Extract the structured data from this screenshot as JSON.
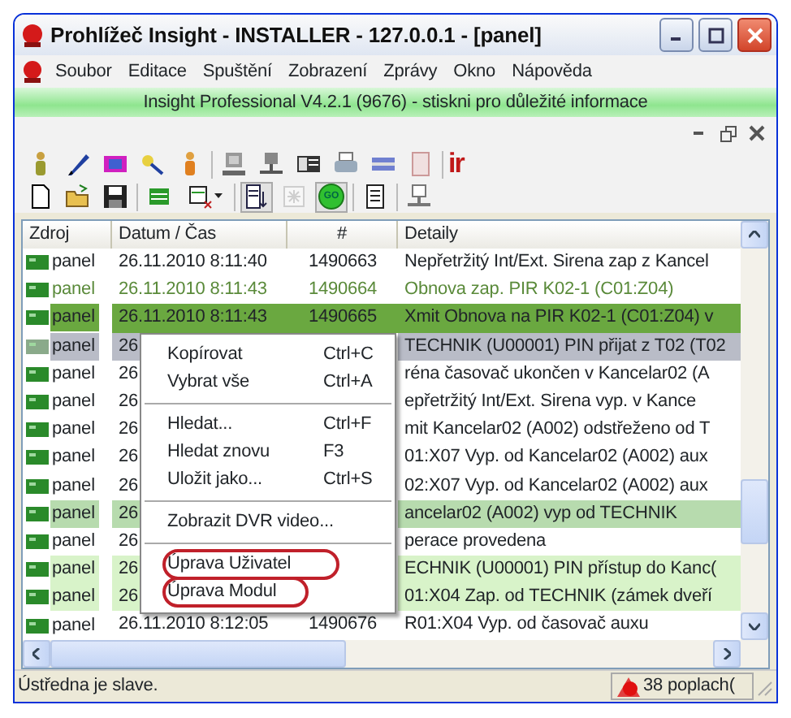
{
  "window": {
    "title": "Prohlížeč Insight - INSTALLER - 127.0.0.1 - [panel]"
  },
  "menu": [
    "Soubor",
    "Editace",
    "Spuštění",
    "Zobrazení",
    "Zprávy",
    "Okno",
    "Nápověda"
  ],
  "banner": "Insight Professional V4.2.1 (9676) - stiskni pro důležité informace",
  "toolbar_1": {
    "logo": "ir"
  },
  "toolbar_2": {
    "go_label": "GO",
    "buttons": [
      {
        "pressed": false,
        "disabled": false
      },
      {
        "pressed": false,
        "disabled": false
      },
      {
        "pressed": false,
        "disabled": false
      },
      {
        "pressed": false,
        "disabled": false
      },
      {
        "pressed": false,
        "disabled": false
      },
      {
        "pressed": true,
        "disabled": false
      },
      {
        "pressed": false,
        "disabled": true
      },
      {
        "pressed": true,
        "disabled": false
      },
      {
        "pressed": false,
        "disabled": false
      },
      {
        "pressed": false,
        "disabled": false
      }
    ]
  },
  "table": {
    "columns": [
      "Zdroj",
      "Datum / Čas",
      "#",
      "Detaily"
    ],
    "rows": [
      {
        "kind": "plain",
        "source": "panel",
        "datetime": "26.11.2010 8:11:40",
        "number": "1490663",
        "details": "Nepřetržitý Int/Ext. Sirena zap z Kancel"
      },
      {
        "kind": "restore",
        "source": "panel",
        "datetime": "26.11.2010 8:11:43",
        "number": "1490664",
        "details": "Obnova zap. PIR K02-1 (C01:Z04)"
      },
      {
        "kind": "selected",
        "source": "panel",
        "datetime": "26.11.2010 8:11:43",
        "number": "1490665",
        "details": "Xmit Obnova na PIR K02-1 (C01:Z04) v"
      },
      {
        "kind": "focused",
        "source": "panel",
        "datetime": "26",
        "details": "TECHNIK (U00001) PIN přijat z T02 (T02"
      },
      {
        "kind": "plain",
        "source": "panel",
        "datetime": "26",
        "details": "réna časovač ukončen v Kancelar02 (A"
      },
      {
        "kind": "plain",
        "source": "panel",
        "datetime": "26",
        "details": "epřetržitý Int/Ext. Sirena vyp. v Kance"
      },
      {
        "kind": "plain",
        "source": "panel",
        "datetime": "26",
        "details": "mit Kancelar02 (A002) odstřeženo od T"
      },
      {
        "kind": "plain",
        "source": "panel",
        "datetime": "26",
        "details": "01:X07 Vyp. od Kancelar02 (A002) aux"
      },
      {
        "kind": "plain",
        "source": "panel",
        "datetime": "26",
        "details": "02:X07 Vyp. od Kancelar02 (A002) aux"
      },
      {
        "kind": "marked",
        "source": "panel",
        "datetime": "26",
        "details": "ancelar02 (A002) vyp od TECHNIK"
      },
      {
        "kind": "plain",
        "source": "panel",
        "datetime": "26",
        "details": "perace provedena"
      },
      {
        "kind": "light",
        "source": "panel",
        "datetime": "26",
        "details": "ECHNIK (U00001) PIN přístup do Kanc("
      },
      {
        "kind": "light",
        "source": "panel",
        "datetime": "26",
        "details": "01:X04 Zap. od TECHNIK (zámek dveří"
      },
      {
        "kind": "plain",
        "source": "panel",
        "datetime": "26.11.2010 8:12:05",
        "number": "1490676",
        "details": "R01:X04 Vyp. od časovač auxu"
      }
    ]
  },
  "context_menu": [
    {
      "kind": "item",
      "label": "Kopírovat",
      "shortcut": "Ctrl+C",
      "circled": false
    },
    {
      "kind": "item",
      "label": "Vybrat vše",
      "shortcut": "Ctrl+A",
      "circled": false
    },
    {
      "kind": "separator"
    },
    {
      "kind": "item",
      "label": "Hledat...",
      "shortcut": "Ctrl+F",
      "circled": false
    },
    {
      "kind": "item",
      "label": "Hledat znovu",
      "shortcut": "F3",
      "circled": false
    },
    {
      "kind": "item",
      "label": "Uložit jako...",
      "shortcut": "Ctrl+S",
      "circled": false
    },
    {
      "kind": "separator"
    },
    {
      "kind": "item",
      "label": "Zobrazit DVR video...",
      "circled": false
    },
    {
      "kind": "separator"
    },
    {
      "kind": "item",
      "label": "Úprava  Uživatel",
      "circled": true
    },
    {
      "kind": "item",
      "label": "Úprava  Modul",
      "circled": true
    }
  ],
  "status_bar": {
    "text": "Ústředna je slave.",
    "alarms": "38 poplach("
  }
}
